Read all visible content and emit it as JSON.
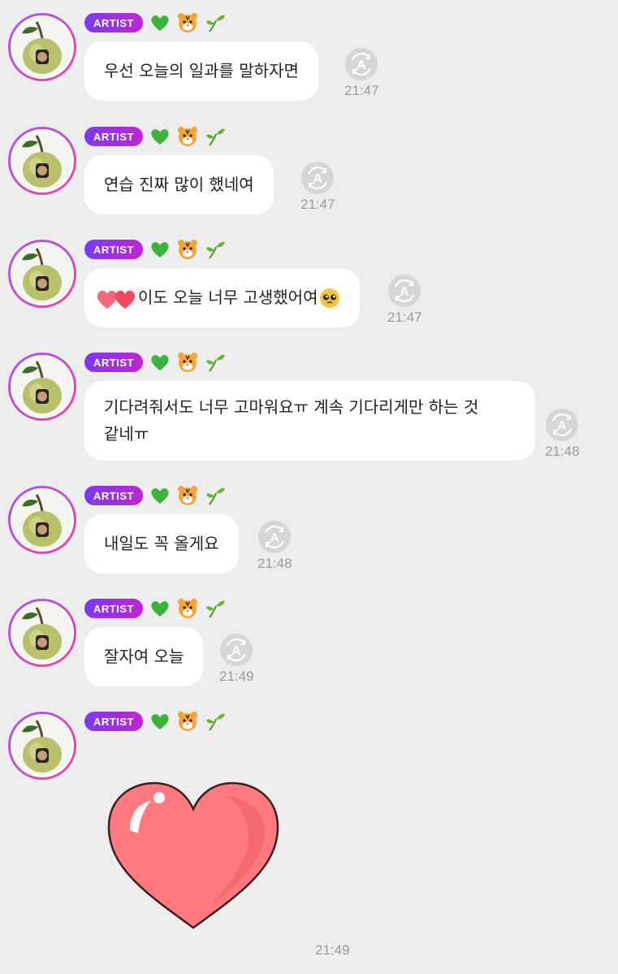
{
  "badge_label": "ARTIST",
  "header_emojis": [
    "green-heart",
    "tiger-face",
    "seedling"
  ],
  "colors": {
    "background": "#ededed",
    "bubble": "#ffffff",
    "badge_start": "#7c3aed",
    "badge_end": "#c026d3",
    "time": "#9a9a9a",
    "heart": "#ff7a7e"
  },
  "messages": [
    {
      "lines": [
        "우선 오늘의 일과를 말하자면"
      ],
      "time": "21:47"
    },
    {
      "lines": [
        "연습 진짜 많이 했네여"
      ],
      "time": "21:47"
    },
    {
      "lines": [
        "이도 오늘 너무 고생했어여"
      ],
      "time": "21:47",
      "prefix_redacted": true,
      "suffix_emoji": "pleading-face"
    },
    {
      "lines": [
        "기다려줘서도 너무 고마워요ㅠ 계속 기다리게만 하는 것",
        "같네ㅠ"
      ],
      "time": "21:48"
    },
    {
      "lines": [
        "내일도 꼭 올게요"
      ],
      "time": "21:48"
    },
    {
      "lines": [
        "잘자여 오늘"
      ],
      "time": "21:49"
    }
  ],
  "sticker": {
    "type": "heart-sticker",
    "time": "21:49"
  }
}
